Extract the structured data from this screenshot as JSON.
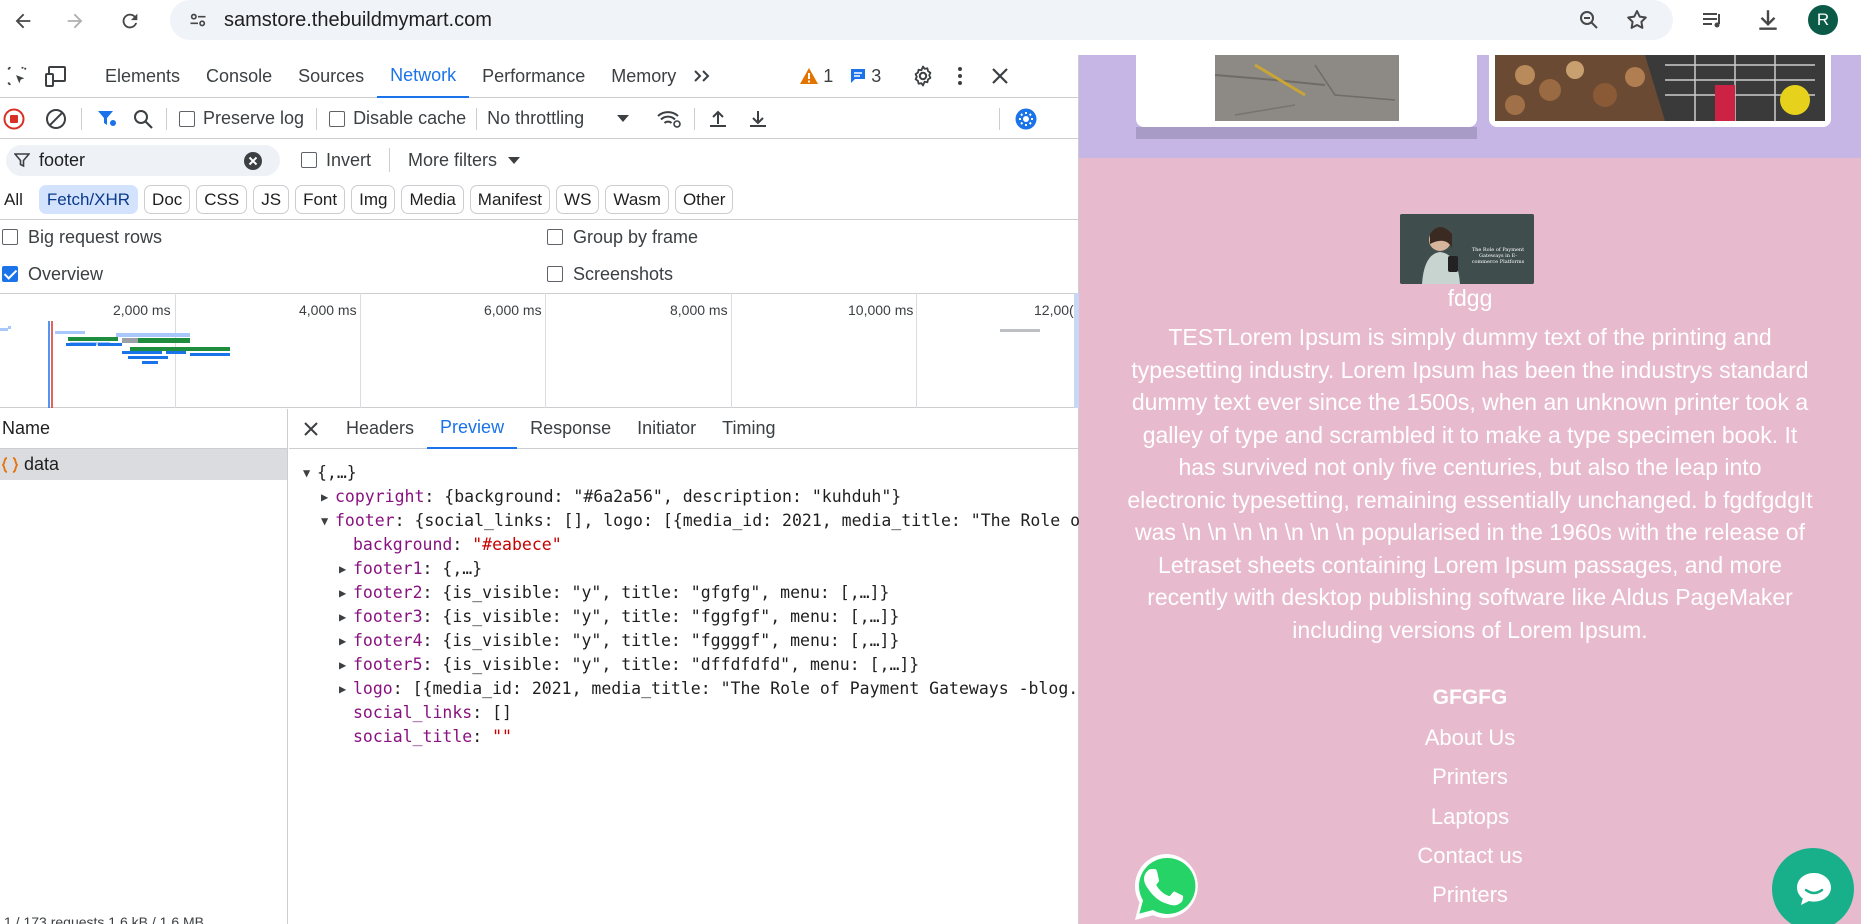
{
  "browser": {
    "url": "samstore.thebuildmymart.com",
    "profile_initial": "R"
  },
  "devtools": {
    "tabs": [
      "Elements",
      "Console",
      "Sources",
      "Network",
      "Performance",
      "Memory"
    ],
    "active_tab": "Network",
    "warnings_count": "1",
    "messages_count": "3",
    "toolbar": {
      "preserve_log": "Preserve log",
      "disable_cache": "Disable cache",
      "throttling": "No throttling"
    },
    "filter": {
      "value": "footer",
      "invert": "Invert",
      "more_filters": "More filters"
    },
    "type_filters": [
      "All",
      "Fetch/XHR",
      "Doc",
      "CSS",
      "JS",
      "Font",
      "Img",
      "Media",
      "Manifest",
      "WS",
      "Wasm",
      "Other"
    ],
    "selected_type": "Fetch/XHR",
    "settings": {
      "big_rows": "Big request rows",
      "group_by_frame": "Group by frame",
      "overview": "Overview",
      "screenshots": "Screenshots"
    },
    "timeline_ticks": [
      "2,000 ms",
      "4,000 ms",
      "6,000 ms",
      "8,000 ms",
      "10,000 ms",
      "12,00("
    ],
    "name_header": "Name",
    "request_name": "data",
    "status_text": "1 / 173 requests   1.6 kB / 1.6 MB",
    "detail_tabs": [
      "Headers",
      "Preview",
      "Response",
      "Initiator",
      "Timing"
    ],
    "active_detail_tab": "Preview",
    "preview": {
      "root": "{,…}",
      "copyright_key": "copyright",
      "copyright_val": "{background: \"#6a2a56\", description: \"kuhduh\"}",
      "footer_key": "footer",
      "footer_val": "{social_links: [], logo: [{media_id: 2021, media_title: \"The Role o",
      "background_key": "background",
      "background_val": "\"#eabece\"",
      "footer1_key": "footer1",
      "footer1_val": "{,…}",
      "footer2_key": "footer2",
      "footer2_val": "{is_visible: \"y\", title: \"gfgfg\", menu: [,…]}",
      "footer3_key": "footer3",
      "footer3_val": "{is_visible: \"y\", title: \"fggfgf\", menu: [,…]}",
      "footer4_key": "footer4",
      "footer4_val": "{is_visible: \"y\", title: \"fggggf\", menu: [,…]}",
      "footer5_key": "footer5",
      "footer5_val": "{is_visible: \"y\", title: \"dffdfdfd\", menu: [,…]}",
      "logo_key": "logo",
      "logo_val": "[{media_id: 2021, media_title: \"The Role of Payment Gateways -blog.",
      "social_links_key": "social_links",
      "social_links_val": "[]",
      "social_title_key": "social_title",
      "social_title_val": "\"\""
    }
  },
  "webpage": {
    "footer_title": "fdgg",
    "footer_description": "TESTLorem Ipsum is simply dummy text of the printing and typesetting industry. Lorem Ipsum has been the industrys standard dummy text ever since the 1500s, when an unknown printer took a galley of type and scrambled it to make a type specimen book. It has survived not only five centuries, but also the leap into electronic typesetting, remaining essentially unchanged. b fgdfgdgIt was \\n \\n \\n \\n \\n \\n \\n popularised in the 1960s with the release of Letraset sheets containing Lorem Ipsum passages, and more recently with desktop publishing software like Aldus PageMaker including versions of Lorem Ipsum.",
    "logo_caption": "The Role of Payment Gateways in E-commerce Platforms",
    "footer_heading": "GFGFG",
    "footer_links": [
      "About Us",
      "Printers",
      "Laptops",
      "Contact us",
      "Printers"
    ],
    "colors": {
      "footer_bg": "#e8bacd",
      "top_bg": "#c5b6e6",
      "accent": "#1a73e8"
    }
  }
}
